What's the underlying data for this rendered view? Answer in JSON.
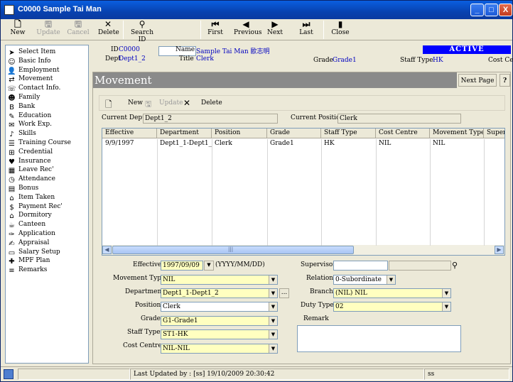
{
  "window": {
    "title": "C0000 Sample Tai Man",
    "min": "_",
    "max": "□",
    "close": "X"
  },
  "toolbar": {
    "new": "New",
    "update": "Update",
    "cancel": "Cancel",
    "delete": "Delete",
    "search_id": "Search ID",
    "first": "First",
    "previous": "Previous",
    "next": "Next",
    "last": "Last",
    "close": "Close",
    "search_value": ""
  },
  "sidebar": {
    "items": [
      "Select Item",
      "Basic Info",
      "Employment",
      "Movement",
      "Contact Info.",
      "Family",
      "Bank",
      "Education",
      "Work Exp.",
      "Skills",
      "Training Course",
      "Credential",
      "Insurance",
      "Leave Rec'",
      "Attendance",
      "Bonus",
      "Item Taken",
      "Payment Rec'",
      "Dormitory",
      "Canteen",
      "Application",
      "Appraisal",
      "Salary Setup",
      "MPF Plan",
      "Remarks"
    ]
  },
  "header": {
    "id_label": "ID",
    "id_value": "C0000",
    "dept_label": "Dept",
    "dept_value": "Dept1_2",
    "name_label": "Name",
    "name_value": "Sample Tai Man 歐志明",
    "title_label": "Title",
    "title_value": "Clerk",
    "grade_label": "Grade",
    "grade_value": "Grade1",
    "stafftype_label": "Staff Type",
    "stafftype_value": "HK",
    "costcentre_label": "Cost Cen",
    "status": "ACTIVE"
  },
  "panel": {
    "title": "Movement",
    "next_page": "Next Page",
    "help": "?",
    "new": "New",
    "update": "Update",
    "delete": "Delete",
    "current_dept_label": "Current Dept.",
    "current_dept": "Dept1_2",
    "current_position_label": "Current Position",
    "current_position": "Clerk"
  },
  "grid": {
    "columns": [
      "Effective",
      "Department",
      "Position",
      "Grade",
      "Staff Type",
      "Cost Centre",
      "Movement Type",
      "Super"
    ],
    "rows": [
      [
        "9/9/1997",
        "Dept1_1-Dept1_2",
        "Clerk",
        "Grade1",
        "HK",
        "NIL",
        "NIL",
        ""
      ]
    ],
    "scroll_mid": "|||"
  },
  "form": {
    "effective_label": "Effective",
    "effective": "1997/09/09",
    "effective_hint": "(YYYY/MM/DD)",
    "movement_type_label": "Movement Type",
    "movement_type": "NIL",
    "department_label": "Department",
    "department": "Dept1_1-Dept1_2",
    "department_btn": "...",
    "position_label": "Position",
    "position": "Clerk",
    "grade_label": "Grade",
    "grade": "G1-Grade1",
    "staff_type_label": "Staff Type",
    "staff_type": "ST1-HK",
    "cost_centre_label": "Cost Centre",
    "cost_centre": "NIL-NIL",
    "supervisor_label": "Supervisor",
    "supervisor": "",
    "supervisor_name": "",
    "relation_label": "Relation",
    "relation": "0-Subordinate",
    "branch_label": "Branch",
    "branch": "(NIL) NIL",
    "duty_type_label": "Duty Type",
    "duty_type": "02",
    "remark_label": "Remark",
    "remark": ""
  },
  "statusbar": {
    "updated": "Last Updated by : [ss]  19/10/2009 20:30:42",
    "user": "ss"
  }
}
